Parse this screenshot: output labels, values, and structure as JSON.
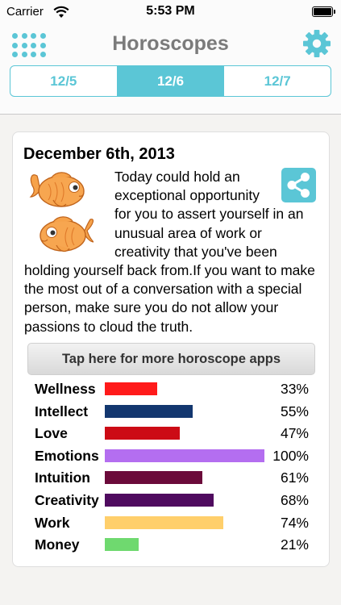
{
  "status_bar": {
    "carrier": "Carrier",
    "time": "5:53 PM"
  },
  "header": {
    "title": "Horoscopes"
  },
  "tabs": [
    {
      "label": "12/5",
      "active": false
    },
    {
      "label": "12/6",
      "active": true
    },
    {
      "label": "12/7",
      "active": false
    }
  ],
  "card": {
    "date": "December 6th, 2013",
    "description": "Today could hold an exceptional opportunity for you to assert yourself in an unusual area of work or creativity that you've been holding yourself back from.If you want to make the most out of a conversation with a special person, make sure you do not allow your passions to cloud the truth.",
    "more_button": "Tap here for more horoscope apps"
  },
  "stats": [
    {
      "label": "Wellness",
      "percent_text": "33%",
      "value": 33,
      "color": "#ff1a1a"
    },
    {
      "label": "Intellect",
      "percent_text": "55%",
      "value": 55,
      "color": "#13376f"
    },
    {
      "label": "Love",
      "percent_text": "47%",
      "value": 47,
      "color": "#cc0b15"
    },
    {
      "label": "Emotions",
      "percent_text": "100%",
      "value": 100,
      "color": "#b46ef0"
    },
    {
      "label": "Intuition",
      "percent_text": "61%",
      "value": 61,
      "color": "#6b0a3a"
    },
    {
      "label": "Creativity",
      "percent_text": "68%",
      "value": 68,
      "color": "#4f0b5f"
    },
    {
      "label": "Work",
      "percent_text": "74%",
      "value": 74,
      "color": "#ffcf6b"
    },
    {
      "label": "Money",
      "percent_text": "21%",
      "value": 21,
      "color": "#6fd96f"
    }
  ],
  "colors": {
    "accent": "#5bc6d6",
    "title_gray": "#7b7b7b"
  },
  "icons": {
    "menu": "grid-dots-icon",
    "settings": "gear-icon",
    "share": "share-icon",
    "zodiac": "pisces-fish-icon"
  }
}
